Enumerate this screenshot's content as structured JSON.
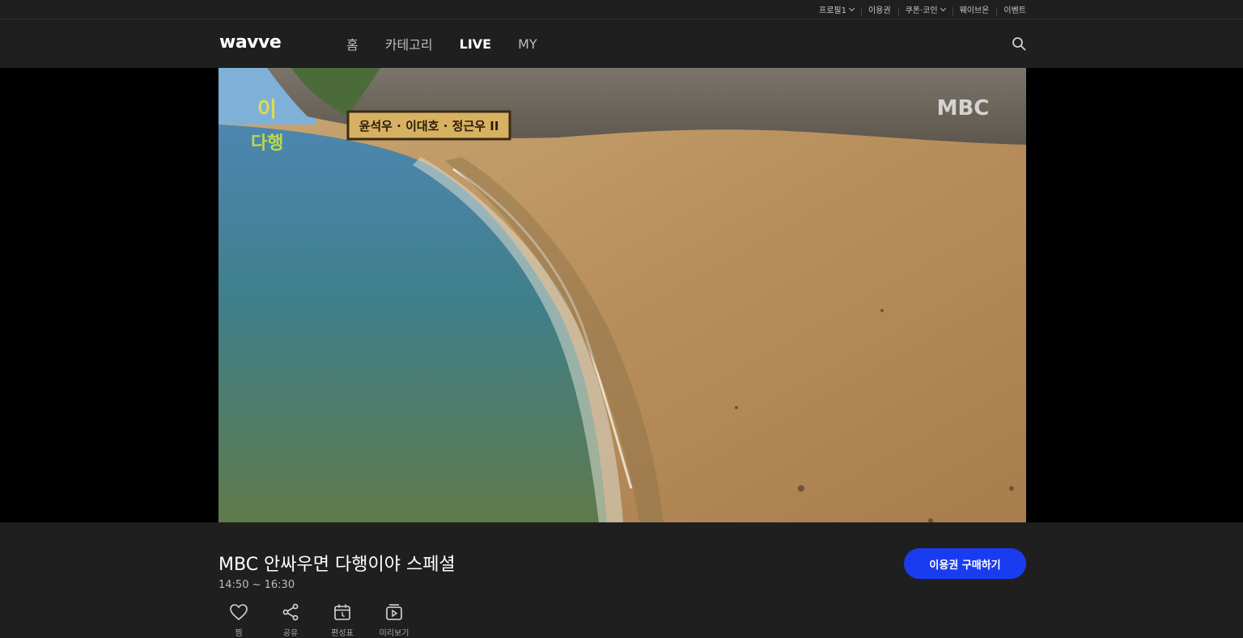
{
  "util_bar": {
    "items": [
      {
        "label": "프로필1",
        "has_caret": true
      },
      {
        "label": "이용권",
        "has_caret": false
      },
      {
        "label": "쿠폰·코인",
        "has_caret": true
      },
      {
        "label": "웨이브온",
        "has_caret": false
      },
      {
        "label": "이벤트",
        "has_caret": false
      }
    ]
  },
  "header": {
    "logo": "wavve",
    "nav": [
      {
        "label": "홈",
        "active": false
      },
      {
        "label": "카테고리",
        "active": false
      },
      {
        "label": "LIVE",
        "active": true
      },
      {
        "label": "MY",
        "active": false
      }
    ],
    "search_icon": "search-icon"
  },
  "player": {
    "channel_watermark": "MBC",
    "caption_text": "윤석우 · 이대호 · 정근우 II"
  },
  "program": {
    "title": "MBC 안싸우면 다행이야 스페셜",
    "time": "14:50 ~ 16:30",
    "buy_button": "이용권 구매하기",
    "actions": [
      {
        "icon": "heart-icon",
        "label": "찜"
      },
      {
        "icon": "share-icon",
        "label": "공유"
      },
      {
        "icon": "calendar-icon",
        "label": "편성표"
      },
      {
        "icon": "play-icon",
        "label": "미리보기"
      }
    ]
  },
  "colors": {
    "background": "#1f1f1f",
    "accent": "#1a3cf0"
  }
}
